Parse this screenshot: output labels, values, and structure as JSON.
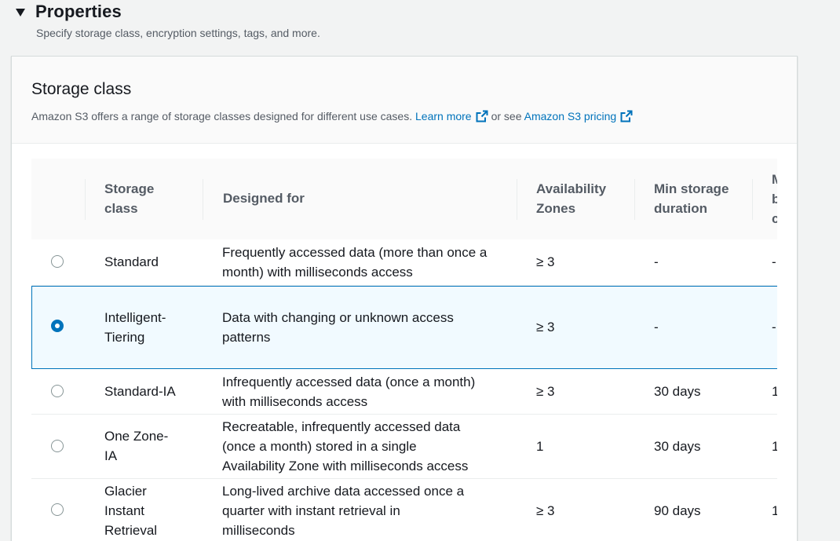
{
  "properties": {
    "title": "Properties",
    "subtitle": "Specify storage class, encryption settings, tags, and more."
  },
  "storage_class": {
    "title": "Storage class",
    "description": "Amazon S3 offers a range of storage classes designed for different use cases.",
    "learn_more": "Learn more",
    "or_see": "or see",
    "pricing_link": "Amazon S3 pricing"
  },
  "table": {
    "headers": {
      "storage_class": [
        "Storage",
        "class"
      ],
      "designed_for": "Designed for",
      "availability_zones": [
        "Availability",
        "Zones"
      ],
      "min_storage": [
        "Min storage",
        "duration"
      ],
      "next_col_partial": [
        "M",
        "b",
        "c"
      ]
    },
    "rows": [
      {
        "selected": false,
        "name": [
          "Standard"
        ],
        "designed_for": [
          "Frequently accessed data (more than once a",
          "month) with milliseconds access"
        ],
        "az": "≥ 3",
        "min_storage": "-",
        "next_partial": "-"
      },
      {
        "selected": true,
        "name": [
          "Intelligent-",
          "Tiering"
        ],
        "designed_for": [
          "Data with changing or unknown access",
          "patterns"
        ],
        "az": "≥ 3",
        "min_storage": "-",
        "next_partial": "-"
      },
      {
        "selected": false,
        "name": [
          "Standard-IA"
        ],
        "designed_for": [
          "Infrequently accessed data (once a month)",
          "with milliseconds access"
        ],
        "az": "≥ 3",
        "min_storage": "30 days",
        "next_partial": "1"
      },
      {
        "selected": false,
        "name": [
          "One Zone-",
          "IA"
        ],
        "designed_for": [
          "Recreatable, infrequently accessed data",
          "(once a month) stored in a single",
          "Availability Zone with milliseconds access"
        ],
        "az": "1",
        "min_storage": "30 days",
        "next_partial": "1"
      },
      {
        "selected": false,
        "name": [
          "Glacier",
          "Instant",
          "Retrieval"
        ],
        "designed_for": [
          "Long-lived archive data accessed once a",
          "quarter with instant retrieval in",
          "milliseconds"
        ],
        "az": "≥ 3",
        "min_storage": "90 days",
        "next_partial": "1"
      }
    ]
  },
  "colors": {
    "link": "#0073bb",
    "selected_bg": "#f1faff",
    "selected_border": "#0073bb"
  }
}
